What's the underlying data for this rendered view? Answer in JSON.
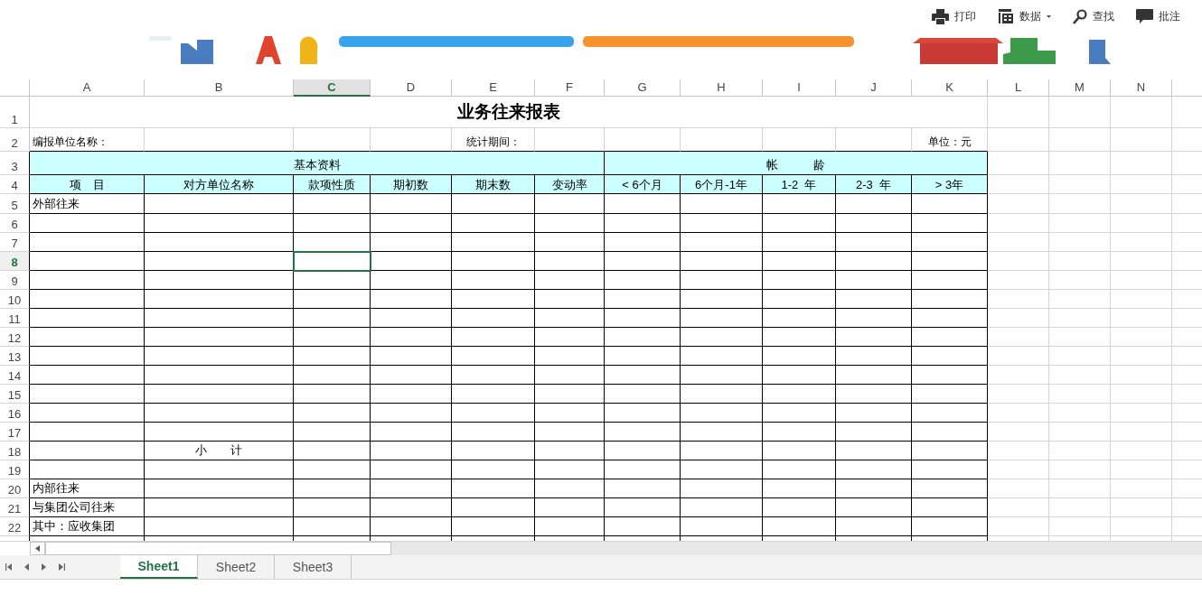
{
  "toolbar": [
    {
      "kind": "print",
      "label": "打印"
    },
    {
      "kind": "data",
      "label": "数据",
      "dropdown": true
    },
    {
      "kind": "find",
      "label": "查找"
    },
    {
      "kind": "comment",
      "label": "批注"
    }
  ],
  "sheet": {
    "columns": [
      {
        "label": "A",
        "selected": false
      },
      {
        "label": "B",
        "selected": false
      },
      {
        "label": "C",
        "selected": true
      },
      {
        "label": "D",
        "selected": false
      },
      {
        "label": "E",
        "selected": false
      },
      {
        "label": "F",
        "selected": false
      },
      {
        "label": "G",
        "selected": false
      },
      {
        "label": "H",
        "selected": false
      },
      {
        "label": "I",
        "selected": false
      },
      {
        "label": "J",
        "selected": false
      },
      {
        "label": "K",
        "selected": false
      },
      {
        "label": "L",
        "selected": false
      },
      {
        "label": "M",
        "selected": false
      },
      {
        "label": "N",
        "selected": false
      }
    ],
    "report_title": "业务往来报表",
    "report_info": {
      "unit_name_label": "编报单位名称：",
      "period_label": "统计期间：",
      "unit_label": "单位：元"
    },
    "header_groups": [
      {
        "text": "基本资料",
        "columns": [
          "项　目",
          "对方单位名称",
          "款项性质",
          "期初数",
          "期末数",
          "变动率"
        ]
      },
      {
        "text": "帐　　　龄",
        "columns": [
          "< 6个月",
          "6个月-1年",
          "1-2  年",
          "2-3  年",
          "> 3年"
        ]
      }
    ],
    "rows": [
      {
        "number": "1",
        "kind": "title",
        "selected": false
      },
      {
        "number": "2",
        "kind": "info",
        "selected": false
      },
      {
        "number": "3",
        "kind": "group",
        "selected": false
      },
      {
        "number": "4",
        "kind": "header",
        "selected": false
      },
      {
        "number": "5",
        "kind": "data",
        "selected": false,
        "item": "外部往来"
      },
      {
        "number": "6",
        "kind": "data",
        "selected": false
      },
      {
        "number": "7",
        "kind": "data",
        "selected": false
      },
      {
        "number": "8",
        "kind": "data",
        "selected": true
      },
      {
        "number": "9",
        "kind": "data",
        "selected": false
      },
      {
        "number": "10",
        "kind": "data",
        "selected": false
      },
      {
        "number": "11",
        "kind": "data",
        "selected": false
      },
      {
        "number": "12",
        "kind": "data",
        "selected": false
      },
      {
        "number": "13",
        "kind": "data",
        "selected": false
      },
      {
        "number": "14",
        "kind": "data",
        "selected": false
      },
      {
        "number": "15",
        "kind": "data",
        "selected": false
      },
      {
        "number": "16",
        "kind": "data",
        "selected": false
      },
      {
        "number": "17",
        "kind": "data",
        "selected": false
      },
      {
        "number": "18",
        "kind": "data",
        "selected": false,
        "counterparty": "小　　计"
      },
      {
        "number": "19",
        "kind": "data",
        "selected": false
      },
      {
        "number": "20",
        "kind": "data",
        "selected": false,
        "item": "内部往来"
      },
      {
        "number": "21",
        "kind": "data",
        "selected": false,
        "item": "与集团公司往来"
      },
      {
        "number": "22",
        "kind": "data",
        "selected": false,
        "item": "其中：应收集团"
      },
      {
        "kind": "data"
      }
    ]
  },
  "sheet_tabs": [
    {
      "label": "Sheet1",
      "selected": true
    },
    {
      "label": "Sheet2",
      "selected": false
    },
    {
      "label": "Sheet3",
      "selected": false
    }
  ]
}
